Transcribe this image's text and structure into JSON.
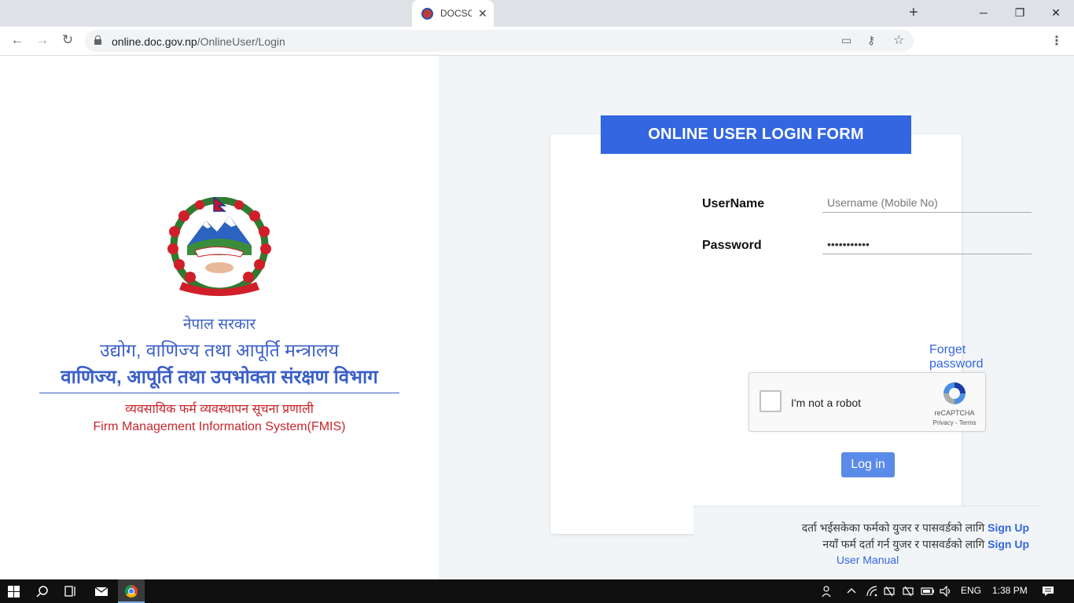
{
  "browser": {
    "tab_title": "DOCSC",
    "tab_close": "✕",
    "new_tab": "+",
    "url_host": "online.doc.gov.np",
    "url_path": "/OnlineUser/Login",
    "window_controls": {
      "minimize": "─",
      "maximize": "❐",
      "close": "✕"
    },
    "nav": {
      "back": "←",
      "forward": "→",
      "reload": "↻"
    },
    "omni_icons": {
      "cast": "▭",
      "key": "⚷",
      "star": "☆"
    },
    "menu": "⋮"
  },
  "left": {
    "line1": "नेपाल सरकार",
    "line2": "उद्योग, वाणिज्य तथा आपूर्ति मन्त्रालय",
    "line3": "वाणिज्य, आपूर्ति तथा उपभोक्ता संरक्षण विभाग",
    "line4": "व्यवसायिक फर्म व्यवस्थापन सूचना प्रणाली",
    "line5": "Firm Management Information System(FMIS)",
    "emblem_motto": "जननी जन्मभूमिश्च स्वर्गादपि गरीयसी"
  },
  "form": {
    "header": "ONLINE USER LOGIN FORM",
    "username_label": "UserName",
    "username_placeholder": "Username (Mobile No)",
    "username_value": "",
    "password_label": "Password",
    "password_value": "•••••••••••",
    "forgot": "Forget password ?",
    "captcha_text": "I'm not a robot",
    "captcha_brand": "reCAPTCHA",
    "captcha_links": "Privacy - Terms",
    "login": "Log in"
  },
  "info": {
    "line1_text": "दर्ता भईसकेका फर्मको युजर र पासवर्डको लागि",
    "line1_link": "Sign Up",
    "line2_text": "नयाँ फर्म दर्ता गर्न युजर र पासवर्डको लागि",
    "line2_link": "Sign Up",
    "manual": "User Manual"
  },
  "taskbar": {
    "lang": "ENG",
    "time": "1:38 PM"
  },
  "colors": {
    "accent_blue": "#3366e0",
    "gov_blue": "#3a5fc8",
    "gov_red": "#c9262b",
    "right_bg": "#f2f5f7"
  }
}
